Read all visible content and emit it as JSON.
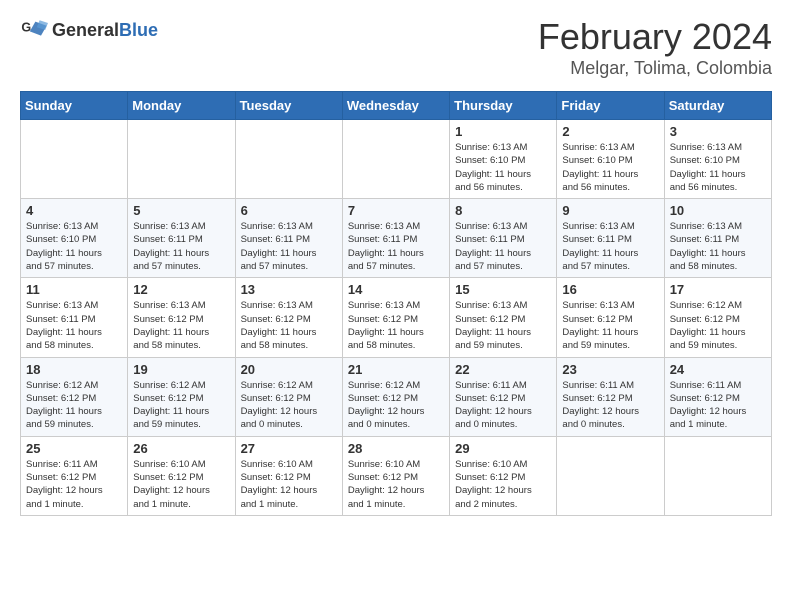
{
  "logo": {
    "text_general": "General",
    "text_blue": "Blue"
  },
  "title": "February 2024",
  "location": "Melgar, Tolima, Colombia",
  "days_of_week": [
    "Sunday",
    "Monday",
    "Tuesday",
    "Wednesday",
    "Thursday",
    "Friday",
    "Saturday"
  ],
  "weeks": [
    [
      {
        "day": "",
        "info": ""
      },
      {
        "day": "",
        "info": ""
      },
      {
        "day": "",
        "info": ""
      },
      {
        "day": "",
        "info": ""
      },
      {
        "day": "1",
        "info": "Sunrise: 6:13 AM\nSunset: 6:10 PM\nDaylight: 11 hours\nand 56 minutes."
      },
      {
        "day": "2",
        "info": "Sunrise: 6:13 AM\nSunset: 6:10 PM\nDaylight: 11 hours\nand 56 minutes."
      },
      {
        "day": "3",
        "info": "Sunrise: 6:13 AM\nSunset: 6:10 PM\nDaylight: 11 hours\nand 56 minutes."
      }
    ],
    [
      {
        "day": "4",
        "info": "Sunrise: 6:13 AM\nSunset: 6:10 PM\nDaylight: 11 hours\nand 57 minutes."
      },
      {
        "day": "5",
        "info": "Sunrise: 6:13 AM\nSunset: 6:11 PM\nDaylight: 11 hours\nand 57 minutes."
      },
      {
        "day": "6",
        "info": "Sunrise: 6:13 AM\nSunset: 6:11 PM\nDaylight: 11 hours\nand 57 minutes."
      },
      {
        "day": "7",
        "info": "Sunrise: 6:13 AM\nSunset: 6:11 PM\nDaylight: 11 hours\nand 57 minutes."
      },
      {
        "day": "8",
        "info": "Sunrise: 6:13 AM\nSunset: 6:11 PM\nDaylight: 11 hours\nand 57 minutes."
      },
      {
        "day": "9",
        "info": "Sunrise: 6:13 AM\nSunset: 6:11 PM\nDaylight: 11 hours\nand 57 minutes."
      },
      {
        "day": "10",
        "info": "Sunrise: 6:13 AM\nSunset: 6:11 PM\nDaylight: 11 hours\nand 58 minutes."
      }
    ],
    [
      {
        "day": "11",
        "info": "Sunrise: 6:13 AM\nSunset: 6:11 PM\nDaylight: 11 hours\nand 58 minutes."
      },
      {
        "day": "12",
        "info": "Sunrise: 6:13 AM\nSunset: 6:12 PM\nDaylight: 11 hours\nand 58 minutes."
      },
      {
        "day": "13",
        "info": "Sunrise: 6:13 AM\nSunset: 6:12 PM\nDaylight: 11 hours\nand 58 minutes."
      },
      {
        "day": "14",
        "info": "Sunrise: 6:13 AM\nSunset: 6:12 PM\nDaylight: 11 hours\nand 58 minutes."
      },
      {
        "day": "15",
        "info": "Sunrise: 6:13 AM\nSunset: 6:12 PM\nDaylight: 11 hours\nand 59 minutes."
      },
      {
        "day": "16",
        "info": "Sunrise: 6:13 AM\nSunset: 6:12 PM\nDaylight: 11 hours\nand 59 minutes."
      },
      {
        "day": "17",
        "info": "Sunrise: 6:12 AM\nSunset: 6:12 PM\nDaylight: 11 hours\nand 59 minutes."
      }
    ],
    [
      {
        "day": "18",
        "info": "Sunrise: 6:12 AM\nSunset: 6:12 PM\nDaylight: 11 hours\nand 59 minutes."
      },
      {
        "day": "19",
        "info": "Sunrise: 6:12 AM\nSunset: 6:12 PM\nDaylight: 11 hours\nand 59 minutes."
      },
      {
        "day": "20",
        "info": "Sunrise: 6:12 AM\nSunset: 6:12 PM\nDaylight: 12 hours\nand 0 minutes."
      },
      {
        "day": "21",
        "info": "Sunrise: 6:12 AM\nSunset: 6:12 PM\nDaylight: 12 hours\nand 0 minutes."
      },
      {
        "day": "22",
        "info": "Sunrise: 6:11 AM\nSunset: 6:12 PM\nDaylight: 12 hours\nand 0 minutes."
      },
      {
        "day": "23",
        "info": "Sunrise: 6:11 AM\nSunset: 6:12 PM\nDaylight: 12 hours\nand 0 minutes."
      },
      {
        "day": "24",
        "info": "Sunrise: 6:11 AM\nSunset: 6:12 PM\nDaylight: 12 hours\nand 1 minute."
      }
    ],
    [
      {
        "day": "25",
        "info": "Sunrise: 6:11 AM\nSunset: 6:12 PM\nDaylight: 12 hours\nand 1 minute."
      },
      {
        "day": "26",
        "info": "Sunrise: 6:10 AM\nSunset: 6:12 PM\nDaylight: 12 hours\nand 1 minute."
      },
      {
        "day": "27",
        "info": "Sunrise: 6:10 AM\nSunset: 6:12 PM\nDaylight: 12 hours\nand 1 minute."
      },
      {
        "day": "28",
        "info": "Sunrise: 6:10 AM\nSunset: 6:12 PM\nDaylight: 12 hours\nand 1 minute."
      },
      {
        "day": "29",
        "info": "Sunrise: 6:10 AM\nSunset: 6:12 PM\nDaylight: 12 hours\nand 2 minutes."
      },
      {
        "day": "",
        "info": ""
      },
      {
        "day": "",
        "info": ""
      }
    ]
  ]
}
